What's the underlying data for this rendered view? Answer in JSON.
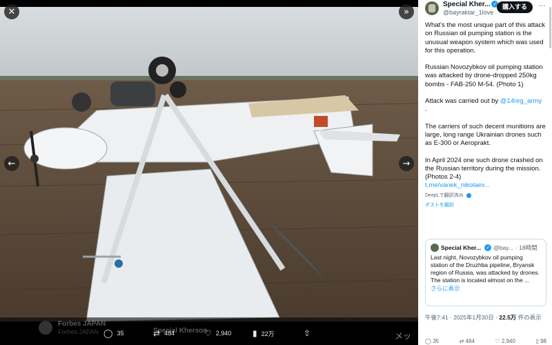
{
  "viewer": {
    "close_icon": "close-icon",
    "expand_icon": "expand-icon",
    "prev_icon": "chevron-left-icon",
    "next_icon": "chevron-right-icon",
    "background_ghost": {
      "name1": "Forbes JAPAN",
      "sub": "Forbes JAPAN",
      "name2": "Special Kherson"
    },
    "actions": {
      "reply_count": "35",
      "repost_count": "484",
      "like_count": "2,940",
      "view_count": "22万"
    }
  },
  "post": {
    "author_name": "Special Kher...",
    "author_handle": "@bayraktar_1love",
    "subscribe_label": "購入する",
    "more_label": "···",
    "para1": "What's the most unique part of this attack on Russian oil pumping station is the unusual weapon system which was used for this operation.",
    "para2": "Russian Novozybkov oil pumping station was attacked by drone-dropped 250kg bombs - FAB-250 M-54. (Photo 1)",
    "para3_prefix": "Attack was carried out by ",
    "para3_link": "@14reg_army",
    "para3_suffix": ".",
    "para4": "The carriers of such decent munitions are large, long range Ukrainian drones such as E-300 or Aeroprakt.",
    "para5": "In April 2024 one such drone crashed on the Russian territory during the mission. (Photos 2-4)",
    "para5_link": "t.me/vanek_nikolaev...",
    "translate_by": "DeepLで翻訳済み",
    "translate_post": "ポストを翻訳",
    "quote": {
      "name": "Special Kher...",
      "handle": "@bay...",
      "time": "· 18時間",
      "text": "Last night, Novozybkov oil pumping station of the Druzhba pipeline, Bryansk region of Russia, was attacked by drones. The station is located almost on the ...",
      "show_more": "さらに表示"
    },
    "timestamp_prefix": "午後7:41 · 2025年1月30日 · ",
    "views_value": "22.5万",
    "views_suffix": " 件の表示",
    "bottom_counts": [
      "35",
      "484",
      "2,940",
      "98"
    ]
  }
}
